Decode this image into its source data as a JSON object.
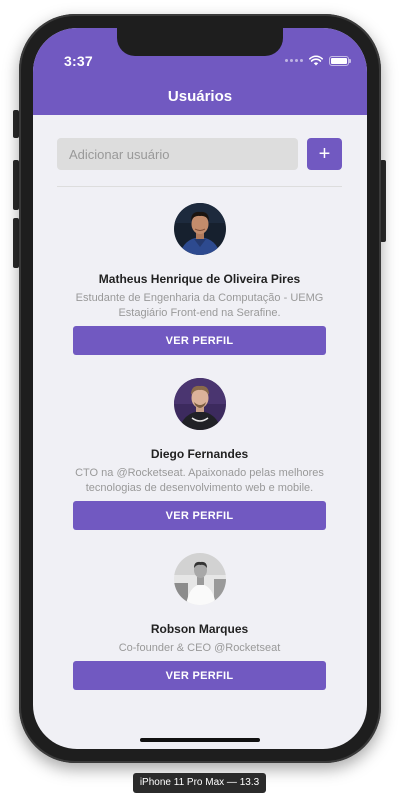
{
  "status_bar": {
    "time": "3:37"
  },
  "header": {
    "title": "Usuários",
    "background_color": "#7159c1"
  },
  "form": {
    "placeholder": "Adicionar usuário",
    "add_label": "+"
  },
  "users": [
    {
      "name": "Matheus Henrique de Oliveira Pires",
      "bio": "Estudante de Engenharia da Computação - UEMG Estagiário Front-end na Serafine.",
      "button_label": "VER PERFIL"
    },
    {
      "name": "Diego Fernandes",
      "bio": "CTO na @Rocketseat. Apaixonado pelas melhores tecnologias de desenvolvimento web e mobile.",
      "button_label": "VER PERFIL"
    },
    {
      "name": "Robson Marques",
      "bio": "Co-founder & CEO @Rocketseat",
      "button_label": "VER PERFIL"
    }
  ],
  "device": {
    "label": "iPhone 11 Pro Max — 13.3"
  },
  "colors": {
    "accent": "#7159c1",
    "background": "#f0f0f5",
    "input_background": "#dddddd",
    "bio_text": "#999999"
  }
}
